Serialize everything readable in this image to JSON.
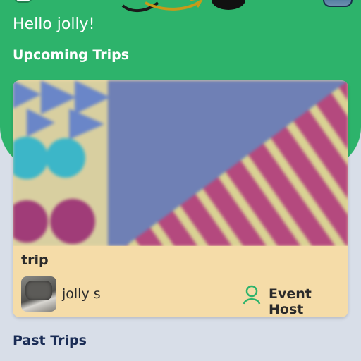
{
  "header": {
    "greeting": "Hello jolly!",
    "brand_color": "#2db36b"
  },
  "sections": {
    "upcoming_title": "Upcoming Trips",
    "past_title": "Past Trips"
  },
  "upcoming_trips": [
    {
      "title": "trip",
      "host_name": "jolly s",
      "host_role": "Event Host",
      "card_color": "#f5dca8"
    }
  ],
  "icons": {
    "top_left": "menu-icon",
    "logo": "app-logo",
    "top_right": "profile-avatar",
    "host_role": "person-icon"
  }
}
